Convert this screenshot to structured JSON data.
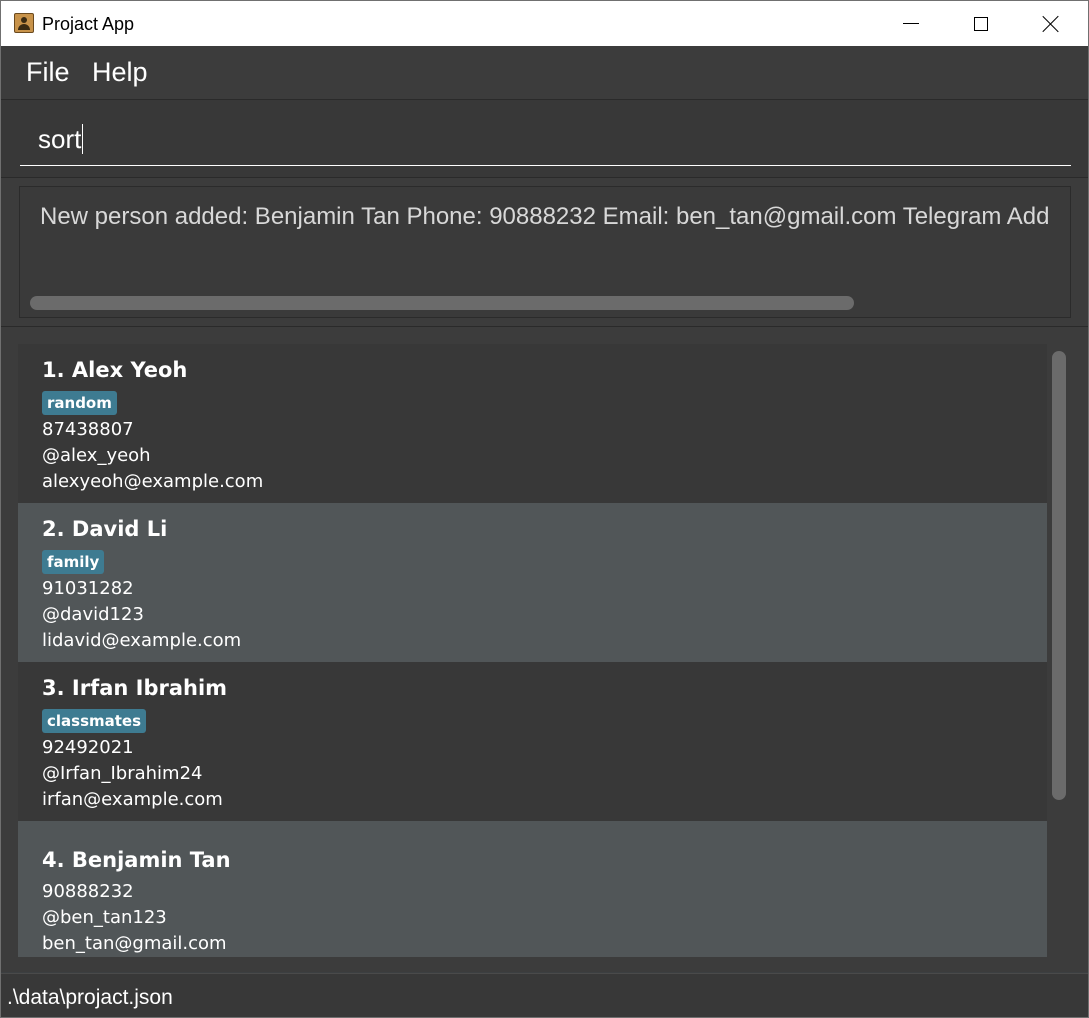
{
  "window": {
    "title": "Projact App"
  },
  "menu": {
    "file": "File",
    "help": "Help"
  },
  "command_box": {
    "value": "sort"
  },
  "result_display": {
    "text": "New person added: Benjamin Tan Phone: 90888232 Email: ben_tan@gmail.com Telegram Add"
  },
  "persons": [
    {
      "name": "1.  Alex Yeoh",
      "tag": "random",
      "phone": "87438807",
      "telegram": "@alex_yeoh",
      "email": "alexyeoh@example.com"
    },
    {
      "name": "2.  David Li",
      "tag": "family",
      "phone": "91031282",
      "telegram": "@david123",
      "email": "lidavid@example.com"
    },
    {
      "name": "3.  Irfan Ibrahim",
      "tag": "classmates",
      "phone": "92492021",
      "telegram": "@Irfan_Ibrahim24",
      "email": "irfan@example.com"
    },
    {
      "name": "4.  Benjamin Tan",
      "phone": "90888232",
      "telegram": "@ben_tan123",
      "email": "ben_tan@gmail.com"
    }
  ],
  "status_bar": {
    "file_path": ".\\data\\projact.json"
  },
  "colors": {
    "background": "#3c3c3c",
    "card_odd": "#383838",
    "card_even": "#515658",
    "tag": "#3e7b91",
    "scrollbar": "#6b6b6b"
  },
  "icons": {
    "app": "address-book-icon",
    "minimize": "minimize-icon",
    "maximize": "maximize-icon",
    "close": "close-icon"
  }
}
